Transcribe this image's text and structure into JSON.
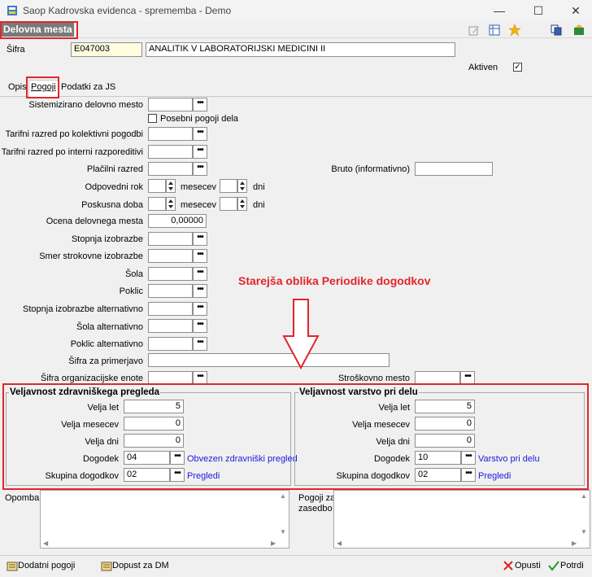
{
  "window": {
    "title": "Saop Kadrovska evidenca - sprememba - Demo",
    "min": "—",
    "max": "☐",
    "close": "✕"
  },
  "header": {
    "title": "Delovna mesta"
  },
  "sifra": {
    "label": "Šifra",
    "code": "E047003",
    "name": "ANALITIK V LABORATORIJSKI MEDICINI II"
  },
  "aktiven": {
    "label": "Aktiven",
    "checked": "✓"
  },
  "tabs": [
    {
      "label": "Opis"
    },
    {
      "label": "Pogoji"
    },
    {
      "label": "Podatki za JS"
    }
  ],
  "form": {
    "sistemizirano": "Sistemizirano delovno mesto",
    "posebni": "Posebni pogoji dela",
    "tarifni_kol": "Tarifni razred po kolektivni pogodbi",
    "tarifni_int": "Tarifni razred po interni razporeditivi",
    "placilni": "Plačilni razred",
    "bruto": "Bruto (informativno)",
    "odpovedni": "Odpovedni rok",
    "poskusna": "Poskusna doba",
    "mesecev": "mesecev",
    "dni": "dni",
    "ocena": "Ocena delovnega mesta",
    "ocena_value": "0,00000",
    "stopnja": "Stopnja izobrazbe",
    "smer": "Smer strokovne izobrazbe",
    "sola": "Šola",
    "poklic": "Poklic",
    "stopnja_alt": "Stopnja izobrazbe alternativno",
    "sola_alt": "Šola alternativno",
    "poklic_alt": "Poklic alternativno",
    "sifra_prim": "Šifra za primerjavo",
    "sifra_org": "Šifra organizacijske enote",
    "strosk": "Stroškovno mesto"
  },
  "annotation": "Starejša oblika Periodike dogodkov",
  "zdrav": {
    "title": "Veljavnost zdravniškega pregleda",
    "velja_let": "Velja let",
    "let": "5",
    "velja_mesecev": "Velja mesecev",
    "mesecev": "0",
    "velja_dni": "Velja dni",
    "dni": "0",
    "dogodek": "Dogodek",
    "dogodek_code": "04",
    "dogodek_name": "Obvezen zdravniški pregled",
    "skupina": "Skupina dogodkov",
    "skupina_code": "02",
    "skupina_name": "Pregledi"
  },
  "varstvo": {
    "title": "Veljavnost varstvo pri delu",
    "velja_let": "Velja let",
    "let": "5",
    "velja_mesecev": "Velja mesecev",
    "mesecev": "0",
    "velja_dni": "Velja dni",
    "dni": "0",
    "dogodek": "Dogodek",
    "dogodek_code": "10",
    "dogodek_name": "Varstvo pri delu",
    "skupina": "Skupina dogodkov",
    "skupina_code": "02",
    "skupina_name": "Pregledi"
  },
  "opomba": {
    "label": "Opomba"
  },
  "pogoji_zas": {
    "label1": "Pogoji za",
    "label2": "zasedbo"
  },
  "footer": {
    "dodatni": "Dodatni pogoji",
    "dopust": "Dopust za DM",
    "opusti": "Opusti",
    "potrdi": "Potrdi"
  },
  "colors": {
    "red": "#e0262d",
    "blue": "#1a1adf",
    "header_bg": "#7a7a7a"
  }
}
